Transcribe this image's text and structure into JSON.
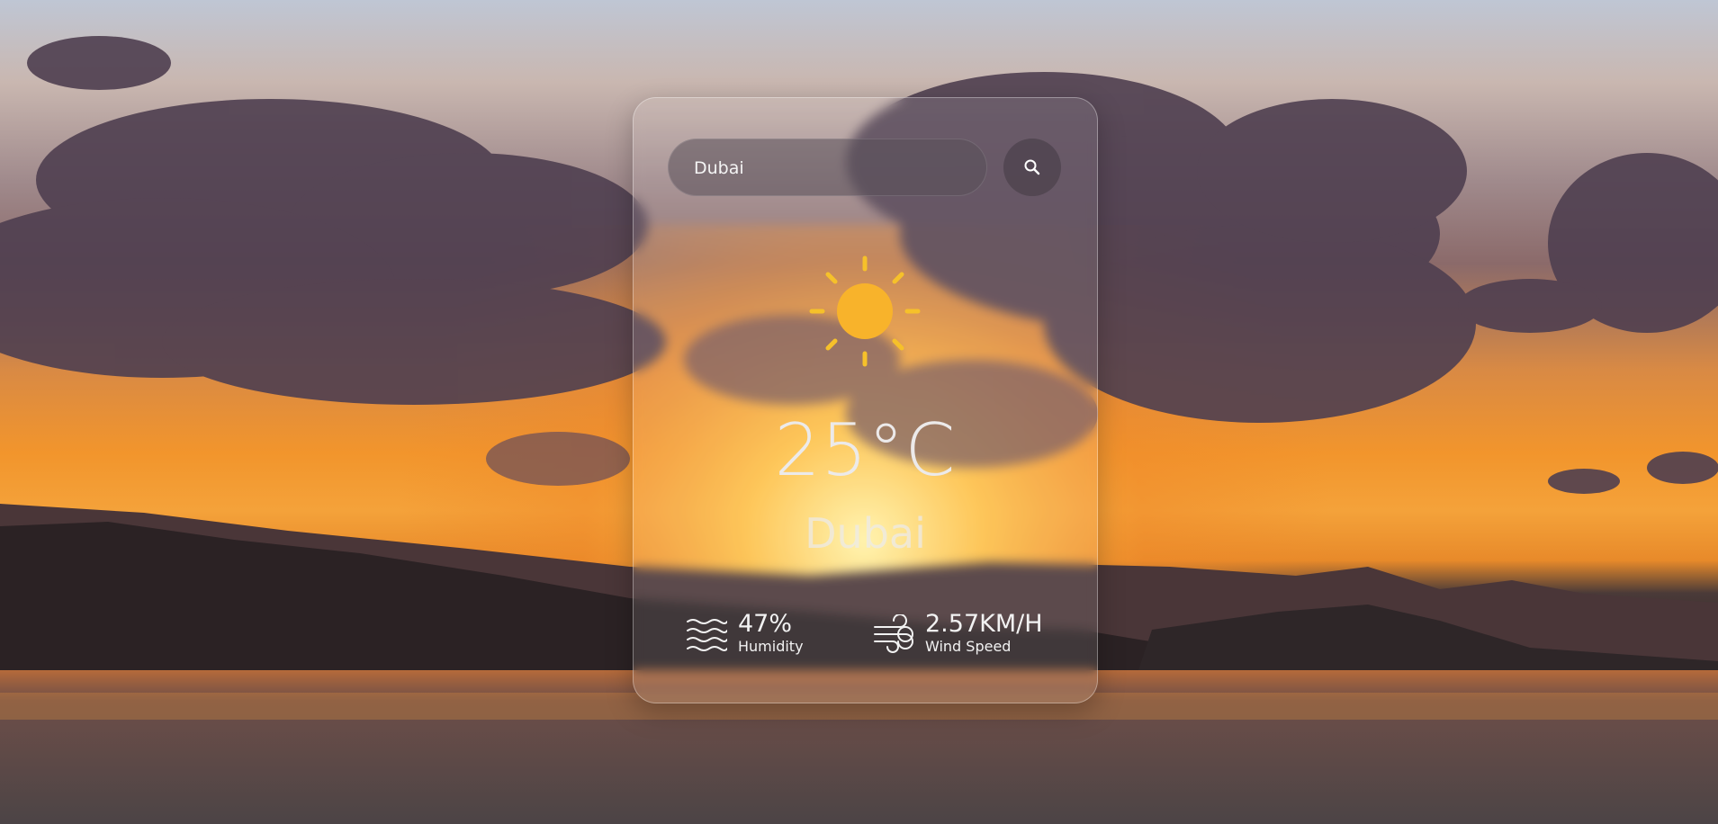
{
  "search": {
    "value": "Dubai",
    "icon": "search-icon"
  },
  "weather": {
    "icon": "sun-icon",
    "temperature": "25°C",
    "city": "Dubai"
  },
  "stats": {
    "humidity": {
      "value": "47%",
      "label": "Humidity",
      "icon": "waves-icon"
    },
    "wind": {
      "value": "2.57KM/H",
      "label": "Wind Speed",
      "icon": "wind-icon"
    }
  },
  "colors": {
    "sun": "#f8b32b",
    "sun_ray": "#f6c12a",
    "text": "#eceaea"
  }
}
